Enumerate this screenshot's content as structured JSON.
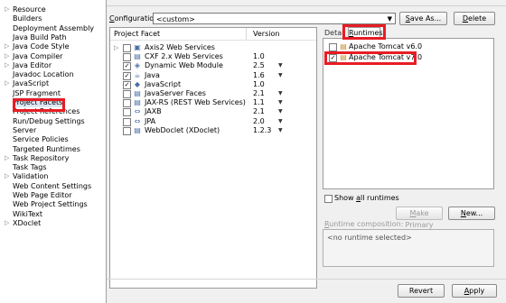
{
  "nav": {
    "items": [
      {
        "label": "Resource",
        "twisty": true
      },
      {
        "label": "Builders",
        "twisty": false
      },
      {
        "label": "Deployment Assembly",
        "twisty": false
      },
      {
        "label": "Java Build Path",
        "twisty": false
      },
      {
        "label": "Java Code Style",
        "twisty": true
      },
      {
        "label": "Java Compiler",
        "twisty": true
      },
      {
        "label": "Java Editor",
        "twisty": true
      },
      {
        "label": "Javadoc Location",
        "twisty": false
      },
      {
        "label": "JavaScript",
        "twisty": true
      },
      {
        "label": "JSP Fragment",
        "twisty": false
      },
      {
        "label": "Project Facets",
        "twisty": false
      },
      {
        "label": "Project References",
        "twisty": false
      },
      {
        "label": "Run/Debug Settings",
        "twisty": false
      },
      {
        "label": "Server",
        "twisty": false
      },
      {
        "label": "Service Policies",
        "twisty": false
      },
      {
        "label": "Targeted Runtimes",
        "twisty": false
      },
      {
        "label": "Task Repository",
        "twisty": true
      },
      {
        "label": "Task Tags",
        "twisty": false
      },
      {
        "label": "Validation",
        "twisty": true
      },
      {
        "label": "Web Content Settings",
        "twisty": false
      },
      {
        "label": "Web Page Editor",
        "twisty": false
      },
      {
        "label": "Web Project Settings",
        "twisty": false
      },
      {
        "label": "WikiText",
        "twisty": false
      },
      {
        "label": "XDoclet",
        "twisty": true
      }
    ]
  },
  "config": {
    "label_pre": "",
    "label_u": "C",
    "label_post": "onfiguration:",
    "value": "<custom>",
    "save_as_u": "S",
    "save_as_rest": "ave As...",
    "delete_u": "D",
    "delete_rest": "elete"
  },
  "facets": {
    "col_facet": "Project Facet",
    "col_version": "Version",
    "rows": [
      {
        "name": "Axis2 Web Services",
        "version": "",
        "checked": false,
        "expand": true,
        "icon": "folder-icon",
        "dropdown": false
      },
      {
        "name": "CXF 2.x Web Services",
        "version": "1.0",
        "checked": false,
        "expand": false,
        "icon": "doc-icon",
        "dropdown": false
      },
      {
        "name": "Dynamic Web Module",
        "version": "2.5",
        "checked": true,
        "expand": false,
        "icon": "web-module-icon",
        "dropdown": true
      },
      {
        "name": "Java",
        "version": "1.6",
        "checked": true,
        "expand": false,
        "icon": "java-icon",
        "dropdown": true
      },
      {
        "name": "JavaScript",
        "version": "1.0",
        "checked": true,
        "expand": false,
        "icon": "javascript-icon",
        "dropdown": false
      },
      {
        "name": "JavaServer Faces",
        "version": "2.1",
        "checked": false,
        "expand": false,
        "icon": "doc-icon",
        "dropdown": true
      },
      {
        "name": "JAX-RS (REST Web Services)",
        "version": "1.1",
        "checked": false,
        "expand": false,
        "icon": "doc-icon",
        "dropdown": true
      },
      {
        "name": "JAXB",
        "version": "2.1",
        "checked": false,
        "expand": false,
        "icon": "jaxb-icon",
        "dropdown": true
      },
      {
        "name": "JPA",
        "version": "2.0",
        "checked": false,
        "expand": false,
        "icon": "jpa-icon",
        "dropdown": true
      },
      {
        "name": "WebDoclet (XDoclet)",
        "version": "1.2.3",
        "checked": false,
        "expand": false,
        "icon": "doc-icon",
        "dropdown": true
      }
    ]
  },
  "tabs": {
    "details": "Detai",
    "runtimes_u": "R",
    "runtimes_rest": "untimes"
  },
  "runtimes": {
    "rows": [
      {
        "name": "Apache Tomcat v6.0",
        "checked": false
      },
      {
        "name": "Apache Tomcat v7.0",
        "checked": true
      }
    ],
    "show_all_pre": "Show ",
    "show_all_u": "a",
    "show_all_post": "ll runtimes",
    "make_primary_u": "M",
    "make_primary_rest": "ake Primary",
    "new_u": "N",
    "new_rest": "ew...",
    "composition_u": "R",
    "composition_rest": "untime composition:",
    "composition_value": "<no runtime selected>"
  },
  "footer": {
    "revert": "Revert",
    "apply_u": "A",
    "apply_rest": "pply"
  },
  "colors": {
    "highlight": "#e81c24",
    "selection": "#dde6f3"
  }
}
